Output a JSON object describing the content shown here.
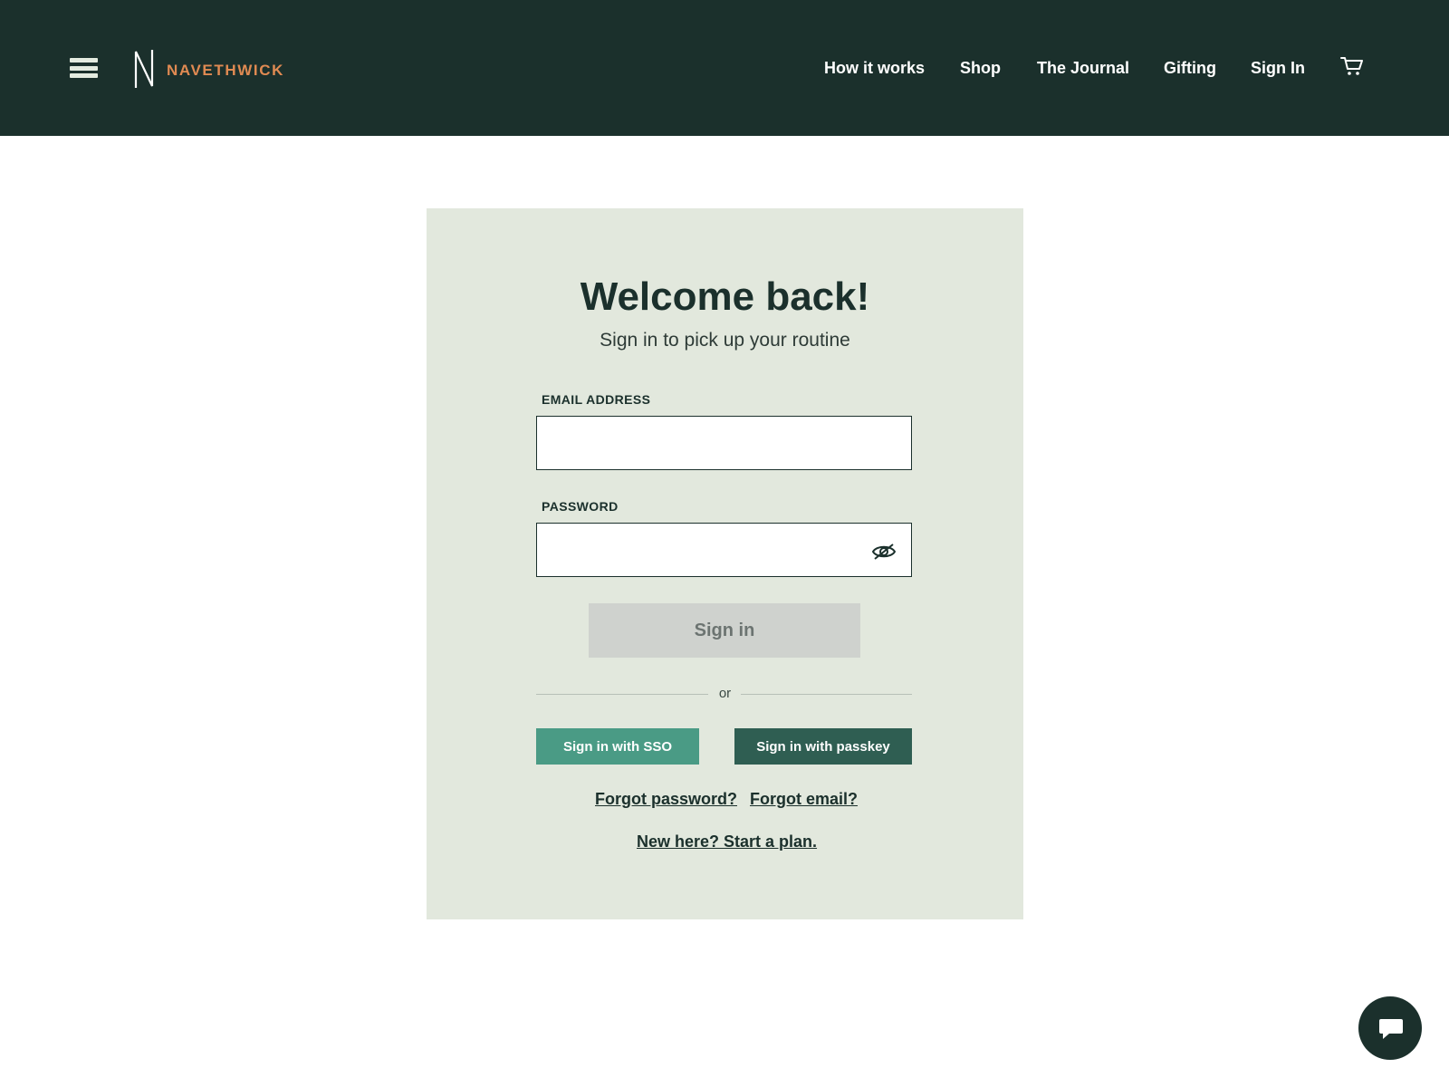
{
  "header": {
    "brand": "NAVETHWICK",
    "nav": [
      "How it works",
      "Shop",
      "The Journal",
      "Gifting",
      "Sign In"
    ],
    "cart_icon": "cart-icon",
    "menu_icon": "hamburger-icon"
  },
  "login": {
    "title": "Welcome back!",
    "subtitle": "Sign in to pick up your routine",
    "email_label": "EMAIL ADDRESS",
    "email_value": "",
    "password_label": "PASSWORD",
    "password_value": "",
    "password_toggle_icon": "eye-slash-icon",
    "signin_label": "Sign in",
    "divider_text": "or",
    "sso_label": "Sign in with SSO",
    "passkey_label": "Sign in with passkey",
    "forgot_password": "Forgot password?",
    "forgot_email": "Forgot email?",
    "new_here": "New here? Start a plan."
  },
  "chat": {
    "icon": "chat-bubble-icon"
  },
  "colors": {
    "header_bg": "#1b302c",
    "brand_accent": "#e08a52",
    "card_bg": "#e2e8dd",
    "sso_button": "#4a9b85",
    "passkey_button": "#2f5e52",
    "disabled_button": "#cfd2ce"
  }
}
